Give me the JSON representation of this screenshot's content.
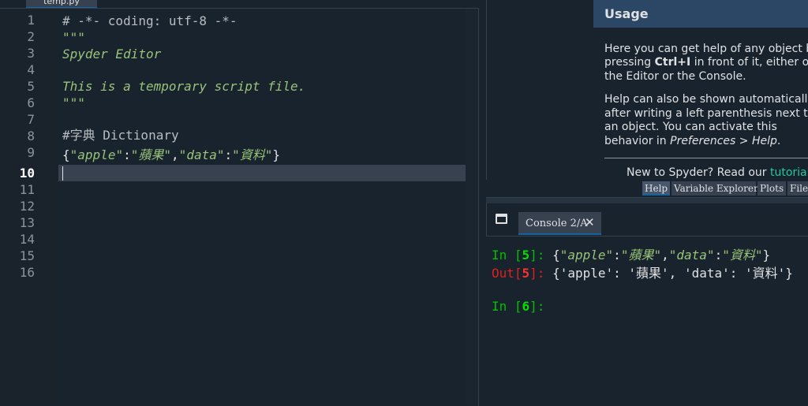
{
  "editor": {
    "tab_label": "temp.py",
    "line_numbers": [
      "1",
      "2",
      "3",
      "4",
      "5",
      "6",
      "7",
      "8",
      "9",
      "10",
      "11",
      "12",
      "13",
      "14",
      "15",
      "16"
    ],
    "current_line": "10",
    "code": {
      "l1": "# -*- coding: utf-8 -*-",
      "l2": "\"\"\"",
      "l3": "Spyder Editor",
      "l5": "This is a temporary script file.",
      "l6": "\"\"\"",
      "l8": "#字典 Dictionary",
      "l9": {
        "open": "{",
        "q1": "\"",
        "key1": "apple",
        "q2": "\"",
        "c1": ":",
        "q3": "\"",
        "val1": "蘋果",
        "q4": "\"",
        "comma": ",",
        "q5": "\"",
        "key2": "data",
        "q6": "\"",
        "c2": ":",
        "q7": "\"",
        "val2": "資料",
        "q8": "\"",
        "close": "}"
      }
    }
  },
  "help": {
    "title": "Usage",
    "p1": [
      "Here you can get help of any object by",
      "pressing ",
      "Ctrl+I",
      " in front of it, either on",
      "the Editor or the Console."
    ],
    "p2": [
      "Help can also be shown automatically",
      "after writing a left parenthesis next to",
      "an object. You can activate this",
      "behavior in ",
      "Preferences > Help",
      "."
    ],
    "bottom_text": "New to Spyder? Read our ",
    "bottom_link": "tutorial",
    "tabs": [
      "Help",
      "Variable Explorer",
      "Plots",
      "Files"
    ]
  },
  "console": {
    "tab_label": "Console 2/A",
    "close_glyph": "✕",
    "lines": [
      {
        "prompt": "In [",
        "num": "5",
        "end": "]: ",
        "text": "{\"apple\":\"蘋果\",\"data\":\"資料\"}"
      },
      {
        "prompt": "Out[",
        "num": "5",
        "end": "]: ",
        "text": "{'apple': '蘋果', 'data': '資料'}"
      },
      {
        "prompt": "In [",
        "num": "6",
        "end": "]:",
        "text": ""
      }
    ]
  },
  "icons": {
    "console_browse": "browse-tabs-icon",
    "close": "close-icon"
  }
}
